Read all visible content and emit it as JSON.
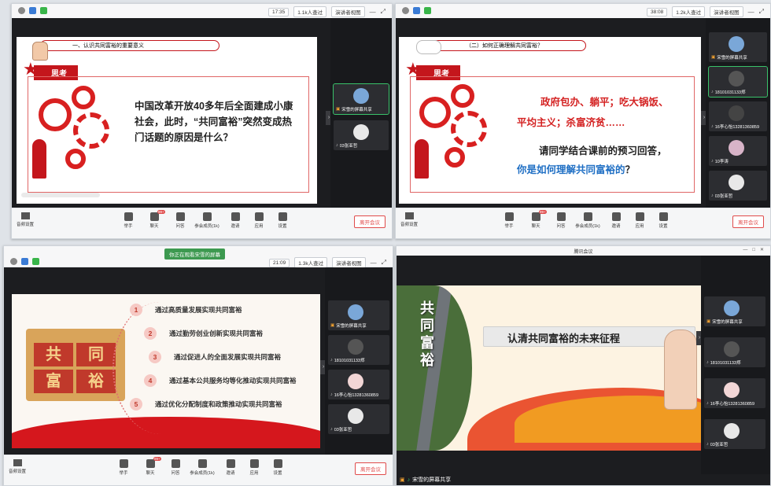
{
  "common": {
    "audio_label": "音频设置",
    "leave_label": "离开会议",
    "view_label": "演讲者视图",
    "participants_label": "参会成员(1k)",
    "tools": [
      "举手",
      "聊天",
      "问答",
      "参会成员(1k)",
      "邀请",
      "应用",
      "设置"
    ],
    "chat_badge": "99+"
  },
  "win1": {
    "timer": "17:35",
    "viewers": "1.1k人查过",
    "ribbon": "一、认识共同富裕的重要意义",
    "badge": "思考",
    "question": "中国改革开放40多年后全面建成小康社会，此时，“共同富裕”突然变成热门话题的原因是什么？",
    "participants": [
      {
        "name": "宋雪的屏幕共享"
      },
      {
        "name": "03张亚哲"
      }
    ]
  },
  "win2": {
    "timer": "38:08",
    "viewers": "1.2k人查过",
    "ribbon": "（二）如何正确理解共同富裕？",
    "badge": "思考",
    "red_lines": [
      "政府包办、躺平；吃大锅饭、",
      "平均主义；杀富济贫……"
    ],
    "black_line": "请同学结合课前的预习回答，",
    "blue_line": "你是如何理解共同富裕的",
    "blue_q": "？",
    "participants": [
      {
        "name": "宋雪的屏幕共享"
      },
      {
        "name": "18101031133郑"
      },
      {
        "name": "16李心怡13281360859"
      },
      {
        "name": "10李涛"
      },
      {
        "name": "03张亚哲"
      }
    ]
  },
  "win3": {
    "banner": "你正在观看宋雪的屏幕",
    "timer": "21:09",
    "viewers": "1.3k人查过",
    "image_chars": [
      "共",
      "同",
      "富",
      "裕"
    ],
    "items": [
      {
        "num": "1",
        "text": "通过高质量发展实现共同富裕"
      },
      {
        "num": "2",
        "text": "通过勤劳创业创新实现共同富裕"
      },
      {
        "num": "3",
        "text": "通过促进人的全面发展实现共同富裕"
      },
      {
        "num": "4",
        "text": "通过基本公共服务均等化推动实现共同富裕"
      },
      {
        "num": "5",
        "text": "通过优化分配制度和政策推动实现共同富裕"
      }
    ],
    "participants": [
      {
        "name": "宋雪的屏幕共享"
      },
      {
        "name": "18101031133郑"
      },
      {
        "name": "16李心怡13281360859"
      },
      {
        "name": "03张亚哲"
      }
    ]
  },
  "win4": {
    "title": "腾讯会议",
    "vertical_text": "共同富裕",
    "headline": "认清共同富裕的未来征程",
    "share_label": "宋雪的屏幕共享",
    "participants": [
      {
        "name": "宋雪的屏幕共享"
      },
      {
        "name": "18101031133郑"
      },
      {
        "name": "16李心怡13281360859"
      },
      {
        "name": "03张亚哲"
      }
    ]
  }
}
